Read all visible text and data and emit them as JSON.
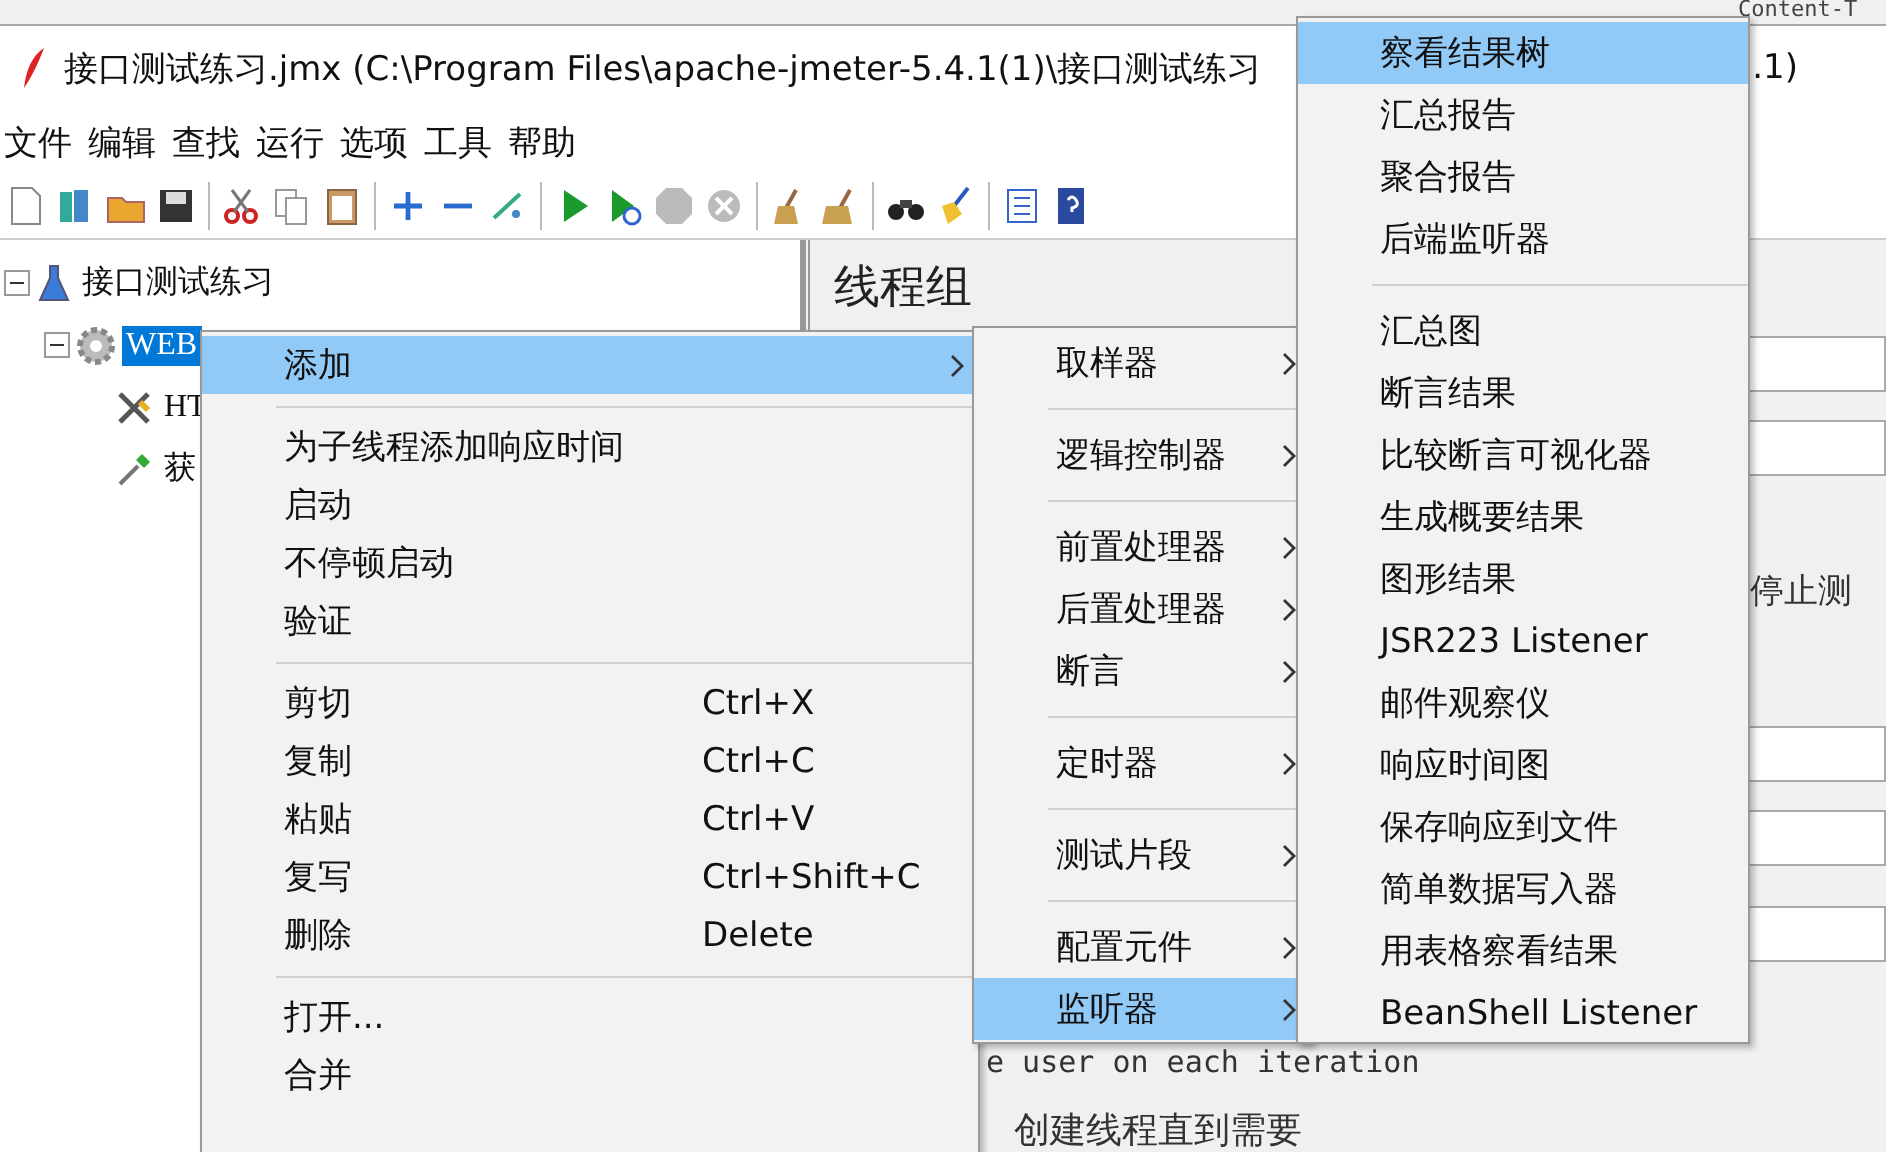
{
  "background_window": {
    "text": "Content-T"
  },
  "window": {
    "title": "接口测试练习.jmx (C:\\Program Files\\apache-jmeter-5.4.1(1)\\接口测试练习",
    "title_tail": ".1)"
  },
  "menu_bar": [
    "文件",
    "编辑",
    "查找",
    "运行",
    "选项",
    "工具",
    "帮助"
  ],
  "tree": [
    {
      "label": "接口测试练习",
      "expanded": true,
      "selected": false,
      "children": [
        {
          "label": "WEB",
          "expanded": true,
          "selected": true,
          "children": [
            {
              "label": "HT",
              "selected": false
            },
            {
              "label": "获",
              "selected": false
            }
          ]
        }
      ]
    }
  ],
  "panel": {
    "title": "线程组",
    "stop_option": "停止测",
    "loop_text": "e user on each iteration",
    "delay_text": "创建线程直到需要"
  },
  "context_menu": [
    {
      "kind": "item",
      "label": "添加",
      "selected": true,
      "submenu": true
    },
    {
      "kind": "separator"
    },
    {
      "kind": "item",
      "label": "为子线程添加响应时间",
      "selected": false,
      "submenu": false
    },
    {
      "kind": "item",
      "label": "启动",
      "selected": false,
      "submenu": false
    },
    {
      "kind": "item",
      "label": "不停顿启动",
      "selected": false,
      "submenu": false
    },
    {
      "kind": "item",
      "label": "验证",
      "selected": false,
      "submenu": false
    },
    {
      "kind": "separator"
    },
    {
      "kind": "item",
      "label": "剪切",
      "shortcut": "Ctrl+X",
      "selected": false,
      "submenu": false
    },
    {
      "kind": "item",
      "label": "复制",
      "shortcut": "Ctrl+C",
      "selected": false,
      "submenu": false
    },
    {
      "kind": "item",
      "label": "粘贴",
      "shortcut": "Ctrl+V",
      "selected": false,
      "submenu": false
    },
    {
      "kind": "item",
      "label": "复写",
      "shortcut": "Ctrl+Shift+C",
      "selected": false,
      "submenu": false
    },
    {
      "kind": "item",
      "label": "删除",
      "shortcut": "Delete",
      "selected": false,
      "submenu": false
    },
    {
      "kind": "separator"
    },
    {
      "kind": "item",
      "label": "打开...",
      "selected": false,
      "submenu": false
    },
    {
      "kind": "item",
      "label": "合并",
      "selected": false,
      "submenu": false
    }
  ],
  "add_submenu": [
    {
      "kind": "item",
      "label": "取样器",
      "selected": false,
      "submenu": true
    },
    {
      "kind": "separator"
    },
    {
      "kind": "item",
      "label": "逻辑控制器",
      "selected": false,
      "submenu": true
    },
    {
      "kind": "separator"
    },
    {
      "kind": "item",
      "label": "前置处理器",
      "selected": false,
      "submenu": true
    },
    {
      "kind": "item",
      "label": "后置处理器",
      "selected": false,
      "submenu": true
    },
    {
      "kind": "item",
      "label": "断言",
      "selected": false,
      "submenu": true
    },
    {
      "kind": "separator"
    },
    {
      "kind": "item",
      "label": "定时器",
      "selected": false,
      "submenu": true
    },
    {
      "kind": "separator"
    },
    {
      "kind": "item",
      "label": "测试片段",
      "selected": false,
      "submenu": true
    },
    {
      "kind": "separator"
    },
    {
      "kind": "item",
      "label": "配置元件",
      "selected": false,
      "submenu": true
    },
    {
      "kind": "item",
      "label": "监听器",
      "selected": true,
      "submenu": true
    }
  ],
  "listener_submenu": [
    {
      "kind": "item",
      "label": "察看结果树",
      "selected": true,
      "submenu": false
    },
    {
      "kind": "item",
      "label": "汇总报告",
      "selected": false,
      "submenu": false
    },
    {
      "kind": "item",
      "label": "聚合报告",
      "selected": false,
      "submenu": false
    },
    {
      "kind": "item",
      "label": "后端监听器",
      "selected": false,
      "submenu": false
    },
    {
      "kind": "separator"
    },
    {
      "kind": "item",
      "label": "汇总图",
      "selected": false,
      "submenu": false
    },
    {
      "kind": "item",
      "label": "断言结果",
      "selected": false,
      "submenu": false
    },
    {
      "kind": "item",
      "label": "比较断言可视化器",
      "selected": false,
      "submenu": false
    },
    {
      "kind": "item",
      "label": "生成概要结果",
      "selected": false,
      "submenu": false
    },
    {
      "kind": "item",
      "label": "图形结果",
      "selected": false,
      "submenu": false
    },
    {
      "kind": "item",
      "label": "JSR223 Listener",
      "selected": false,
      "submenu": false
    },
    {
      "kind": "item",
      "label": "邮件观察仪",
      "selected": false,
      "submenu": false
    },
    {
      "kind": "item",
      "label": "响应时间图",
      "selected": false,
      "submenu": false
    },
    {
      "kind": "item",
      "label": "保存响应到文件",
      "selected": false,
      "submenu": false
    },
    {
      "kind": "item",
      "label": "简单数据写入器",
      "selected": false,
      "submenu": false
    },
    {
      "kind": "item",
      "label": "用表格察看结果",
      "selected": false,
      "submenu": false
    },
    {
      "kind": "item",
      "label": "BeanShell Listener",
      "selected": false,
      "submenu": false
    }
  ]
}
